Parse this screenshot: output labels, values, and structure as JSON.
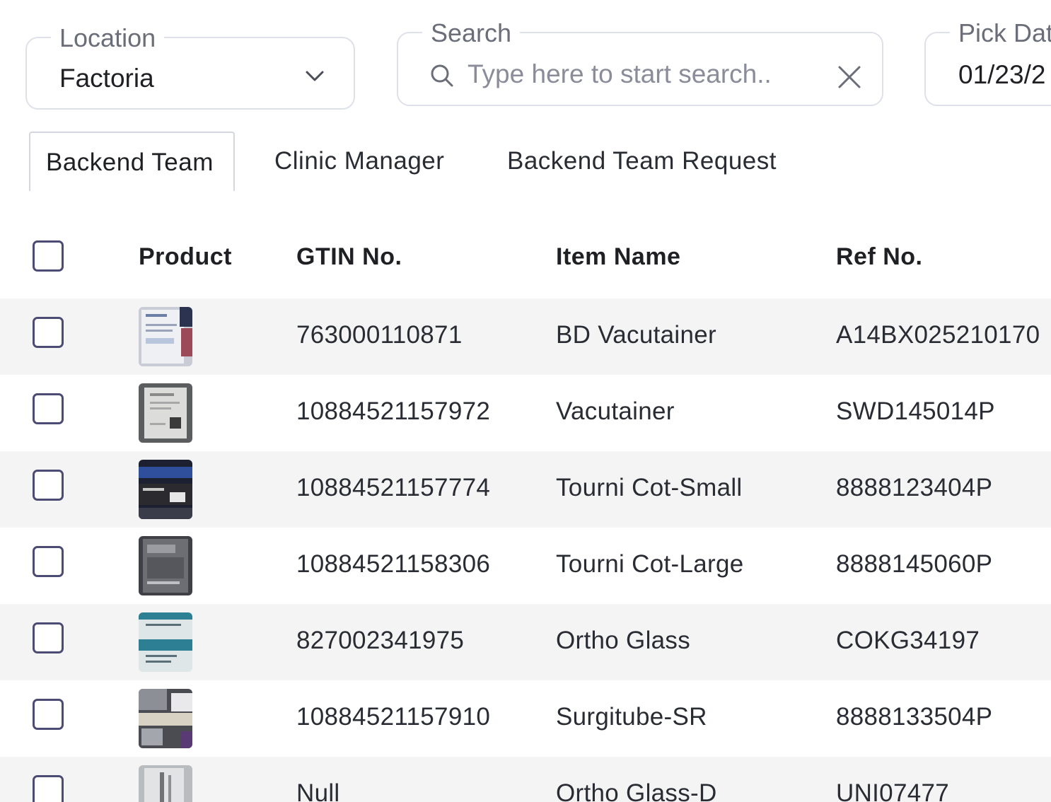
{
  "filters": {
    "location": {
      "label": "Location",
      "value": "Factoria"
    },
    "search": {
      "label": "Search",
      "placeholder": "Type here to start search..",
      "value": ""
    },
    "date": {
      "label": "Pick Date",
      "value": "01/23/2"
    }
  },
  "tabs": [
    {
      "label": "Backend Team",
      "active": true
    },
    {
      "label": "Clinic Manager",
      "active": false
    },
    {
      "label": "Backend Team Request",
      "active": false
    }
  ],
  "table": {
    "columns": [
      "Product",
      "GTIN No.",
      "Item Name",
      "Ref No."
    ],
    "rows": [
      {
        "gtin": "763000110871",
        "name": "BD Vacutainer",
        "ref": "A14BX025210170"
      },
      {
        "gtin": "10884521157972",
        "name": "Vacutainer",
        "ref": "SWD145014P"
      },
      {
        "gtin": "10884521157774",
        "name": "Tourni Cot-Small",
        "ref": "8888123404P"
      },
      {
        "gtin": "10884521158306",
        "name": "Tourni Cot-Large",
        "ref": "8888145060P"
      },
      {
        "gtin": "827002341975",
        "name": "Ortho Glass",
        "ref": "COKG34197"
      },
      {
        "gtin": "10884521157910",
        "name": "Surgitube-SR",
        "ref": "8888133504P"
      },
      {
        "gtin": "Null",
        "name": "Ortho Glass-D",
        "ref": "UNI07477"
      }
    ]
  },
  "colors": {
    "checkbox_border": "#4b4b73",
    "row_stripe": "#f4f4f5",
    "field_border": "#dfe1ea"
  },
  "icons": {
    "location_dropdown": "chevron-down-icon",
    "search": "search-icon",
    "clear": "close-icon"
  }
}
